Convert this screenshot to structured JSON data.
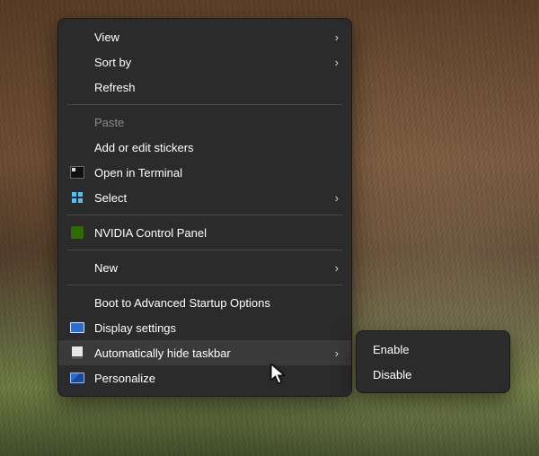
{
  "menu": {
    "view": {
      "label": "View"
    },
    "sort": {
      "label": "Sort by"
    },
    "refresh": {
      "label": "Refresh"
    },
    "paste": {
      "label": "Paste"
    },
    "stickers": {
      "label": "Add or edit stickers"
    },
    "terminal": {
      "label": "Open in Terminal"
    },
    "select": {
      "label": "Select"
    },
    "nvidia": {
      "label": "NVIDIA Control Panel"
    },
    "new": {
      "label": "New"
    },
    "bootadv": {
      "label": "Boot to Advanced Startup Options"
    },
    "display": {
      "label": "Display settings"
    },
    "autohide": {
      "label": "Automatically hide taskbar"
    },
    "personalize": {
      "label": "Personalize"
    }
  },
  "submenu": {
    "enable": {
      "label": "Enable"
    },
    "disable": {
      "label": "Disable"
    }
  },
  "chevron": "›"
}
